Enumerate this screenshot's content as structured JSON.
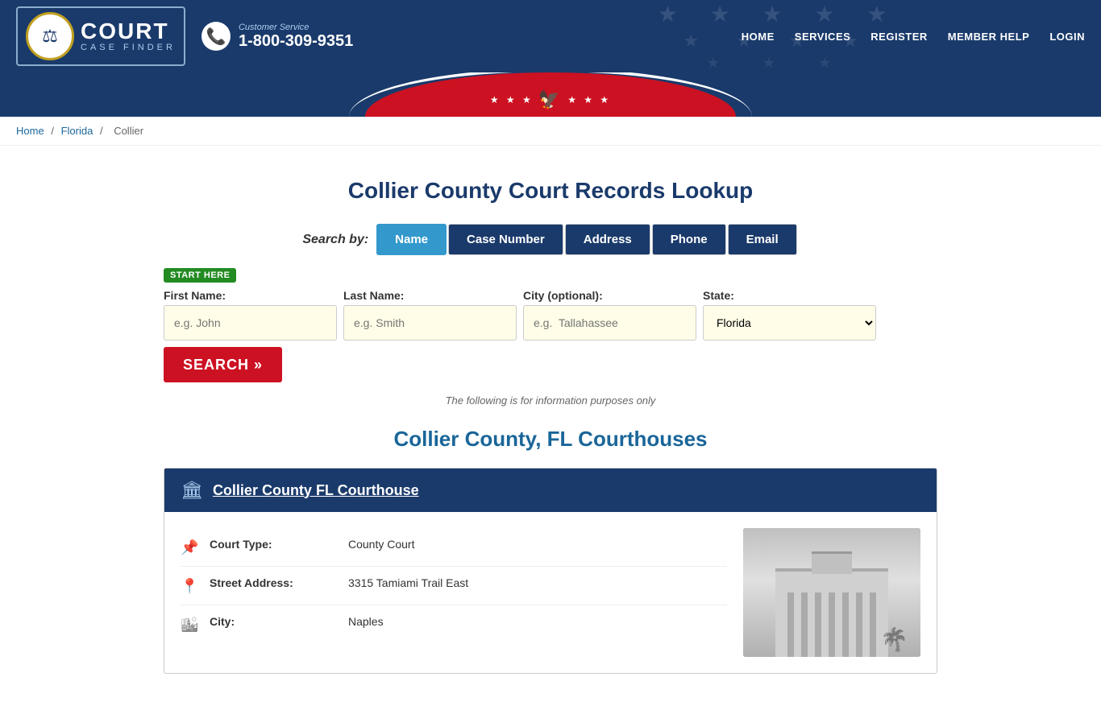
{
  "header": {
    "logo": {
      "badge_icon": "⚖",
      "court_text": "COURT",
      "case_finder_text": "CASE FINDER"
    },
    "customer_service": {
      "label": "Customer Service",
      "phone": "1-800-309-9351"
    },
    "nav": {
      "items": [
        {
          "label": "HOME",
          "href": "#"
        },
        {
          "label": "SERVICES",
          "href": "#"
        },
        {
          "label": "REGISTER",
          "href": "#"
        },
        {
          "label": "MEMBER HELP",
          "href": "#"
        },
        {
          "label": "LOGIN",
          "href": "#"
        }
      ]
    },
    "eagle_stars_left": "★ ★ ★",
    "eagle_icon": "🦅",
    "eagle_stars_right": "★ ★ ★"
  },
  "breadcrumb": {
    "home": "Home",
    "sep1": "/",
    "florida": "Florida",
    "sep2": "/",
    "current": "Collier"
  },
  "main": {
    "page_title": "Collier County Court Records Lookup",
    "search": {
      "search_by_label": "Search by:",
      "tabs": [
        {
          "label": "Name",
          "active": true
        },
        {
          "label": "Case Number",
          "active": false
        },
        {
          "label": "Address",
          "active": false
        },
        {
          "label": "Phone",
          "active": false
        },
        {
          "label": "Email",
          "active": false
        }
      ],
      "start_here": "START HERE",
      "fields": {
        "first_name_label": "First Name:",
        "first_name_placeholder": "e.g. John",
        "last_name_label": "Last Name:",
        "last_name_placeholder": "e.g. Smith",
        "city_label": "City (optional):",
        "city_placeholder": "e.g.  Tallahassee",
        "state_label": "State:",
        "state_default": "Florida"
      },
      "search_button": "SEARCH »",
      "info_note": "The following is for information purposes only"
    },
    "courthouses_title": "Collier County, FL Courthouses",
    "courthouses": [
      {
        "name": "Collier County FL Courthouse",
        "details": [
          {
            "icon": "📌",
            "label": "Court Type:",
            "value": "County Court"
          },
          {
            "icon": "📍",
            "label": "Street Address:",
            "value": "3315 Tamiami Trail East"
          },
          {
            "icon": "🏙",
            "label": "City:",
            "value": "Naples"
          }
        ]
      }
    ]
  }
}
